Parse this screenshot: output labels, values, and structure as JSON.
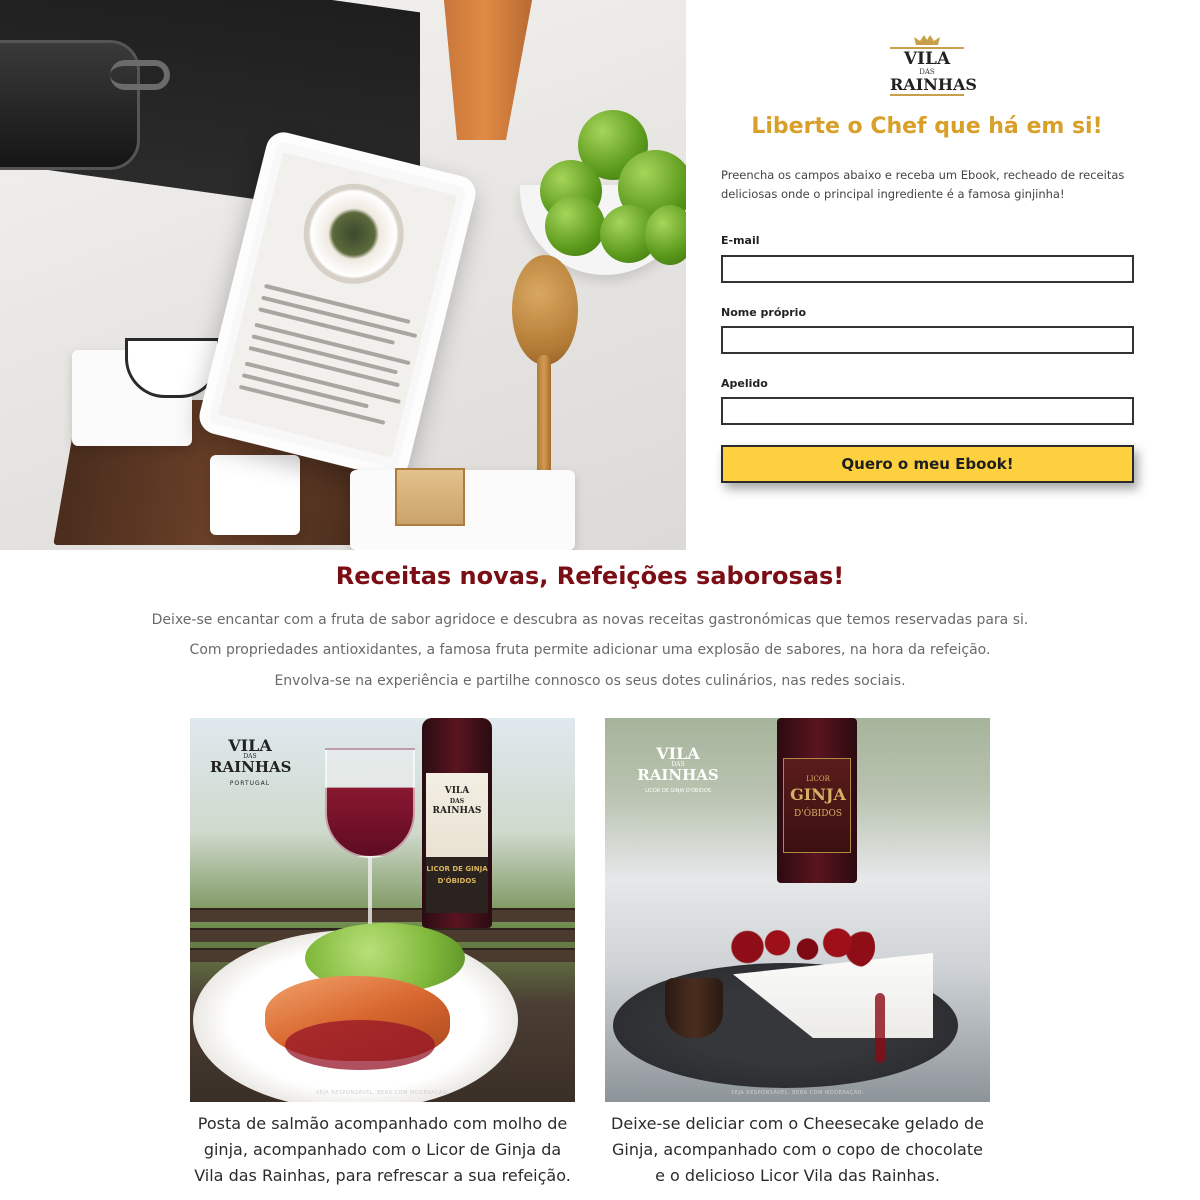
{
  "brand": {
    "logo_line1": "VILA",
    "logo_line2": "DAS",
    "logo_line3": "RAINHAS"
  },
  "form": {
    "title": "Liberte o Chef que há em si!",
    "intro": "Preencha os campos abaixo e receba um Ebook, recheado de receitas deliciosas onde o principal ingrediente é a famosa ginjinha!",
    "fields": [
      {
        "label": "E-mail",
        "value": ""
      },
      {
        "label": "Nome próprio",
        "value": ""
      },
      {
        "label": "Apelido",
        "value": ""
      }
    ],
    "submit_label": "Quero o meu Ebook!"
  },
  "recipes_section": {
    "title": "Receitas novas, Refeições saborosas!",
    "lines": [
      "Deixe-se encantar com a fruta de sabor agridoce e descubra as novas receitas gastronómicas que temos reservadas para si.",
      "Com propriedades antioxidantes, a famosa fruta permite adicionar uma explosão de sabores, na hora da refeição.",
      "Envolva-se na experiência e partilhe connosco os seus dotes culinários, nas redes sociais."
    ],
    "cards": [
      {
        "image": {
          "logo_line1": "VILA",
          "logo_line2": "DAS",
          "logo_line3": "RAINHAS",
          "logo_line4": "PORTUGAL",
          "bottle_line1": "VILA",
          "bottle_line2": "DAS",
          "bottle_line3": "RAINHAS",
          "bottle_label": "LICOR DE GINJA",
          "bottle_sub": "D'ÓBIDOS",
          "note": "SEJA RESPONSÁVEL. BEBA COM MODERAÇÃO."
        },
        "caption": "Posta de salmão acompanhado com molho de ginja, acompanhado com o Licor de Ginja da Vila das Rainhas, para refrescar a sua refeição."
      },
      {
        "image": {
          "logo_line1": "VILA",
          "logo_line2": "DAS",
          "logo_line3": "RAINHAS",
          "logo_line4": "LICOR DE GINJA D'ÓBIDOS",
          "bottle_line1": "LICOR",
          "bottle_line2": "GINJA",
          "bottle_line3": "D'ÓBIDOS",
          "note": "SEJA RESPONSÁVEL. BEBA COM MODERAÇÃO."
        },
        "caption": "Deixe-se deliciar com o Cheesecake gelado de Ginja, acompanhado com o copo de chocolate e o delicioso Licor Vila das Rainhas."
      }
    ]
  },
  "colors": {
    "form_title": "#d8a028",
    "section_title": "#7b0d14",
    "button_bg": "#fdd03f"
  }
}
